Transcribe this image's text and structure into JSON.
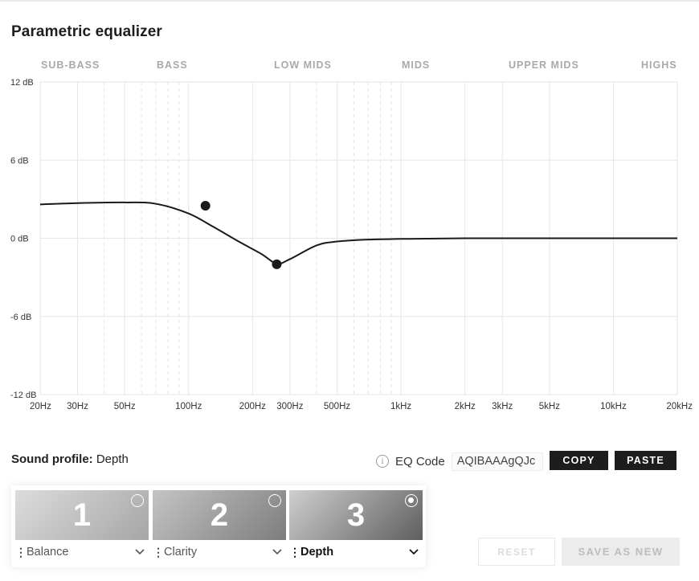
{
  "title": "Parametric equalizer",
  "bands": [
    "SUB-BASS",
    "BASS",
    "LOW MIDS",
    "MIDS",
    "UPPER MIDS",
    "HIGHS"
  ],
  "chart_data": {
    "type": "line",
    "xscale": "log",
    "xlim": [
      20,
      20000
    ],
    "ylim": [
      -12,
      12
    ],
    "y_ticks": [
      "12 dB",
      "6 dB",
      "0 dB",
      "-6 dB",
      "-12 dB"
    ],
    "x_ticks": [
      "20Hz",
      "30Hz",
      "50Hz",
      "100Hz",
      "200Hz",
      "300Hz",
      "500Hz",
      "1kHz",
      "2kHz",
      "3kHz",
      "5kHz",
      "10kHz",
      "20kHz"
    ],
    "grid": true,
    "curve": [
      [
        20,
        2.6
      ],
      [
        30,
        2.7
      ],
      [
        50,
        2.75
      ],
      [
        70,
        2.65
      ],
      [
        100,
        1.9
      ],
      [
        130,
        0.9
      ],
      [
        170,
        -0.2
      ],
      [
        220,
        -1.2
      ],
      [
        260,
        -1.95
      ],
      [
        300,
        -1.6
      ],
      [
        400,
        -0.55
      ],
      [
        500,
        -0.25
      ],
      [
        700,
        -0.1
      ],
      [
        1000,
        -0.05
      ],
      [
        2000,
        0
      ],
      [
        5000,
        0
      ],
      [
        10000,
        0
      ],
      [
        20000,
        0
      ]
    ],
    "points": [
      [
        120,
        2.5
      ],
      [
        260,
        -2
      ]
    ]
  },
  "profile": {
    "label": "Sound profile:",
    "value": "Depth"
  },
  "eq_code": {
    "label": "EQ Code",
    "value": "AQIBAAAgQJc"
  },
  "buttons": {
    "copy": "COPY",
    "paste": "PASTE",
    "reset": "RESET",
    "save_as_new": "SAVE AS NEW"
  },
  "presets": [
    {
      "number": "1",
      "name": "Balance",
      "selected": false
    },
    {
      "number": "2",
      "name": "Clarity",
      "selected": false
    },
    {
      "number": "3",
      "name": "Depth",
      "selected": true
    }
  ],
  "icons": {
    "info": "info-icon",
    "chevron": "chevron-down-icon",
    "drag": "drag-handle-icon",
    "radio": "radio-icon"
  }
}
